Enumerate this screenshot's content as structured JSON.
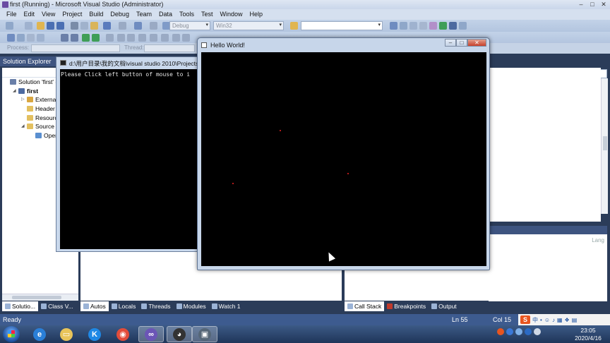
{
  "vs": {
    "title": "first (Running) - Microsoft Visual Studio (Administrator)",
    "window_controls": [
      "–",
      "□",
      "✕"
    ],
    "menu": [
      "File",
      "Edit",
      "View",
      "Project",
      "Build",
      "Debug",
      "Team",
      "Data",
      "Tools",
      "Test",
      "Window",
      "Help"
    ],
    "toolbar": {
      "config": "Debug",
      "platform": "Win32"
    },
    "debug_bar": {
      "process_label": "Process:",
      "thread_label": "Thread:"
    },
    "solution_explorer": {
      "title": "Solution Explorer",
      "items": [
        {
          "label": "Solution 'first' (",
          "indent": 0,
          "icon_color": "#6a7fa8"
        },
        {
          "label": "first",
          "indent": 1,
          "icon_color": "#4d6aa0",
          "bold": true
        },
        {
          "label": "External",
          "indent": 2,
          "icon_color": "#d9a640"
        },
        {
          "label": "Header F",
          "indent": 2,
          "icon_color": "#e3c060"
        },
        {
          "label": "Resource",
          "indent": 2,
          "icon_color": "#e3c060"
        },
        {
          "label": "Source F",
          "indent": 2,
          "icon_color": "#e3c060"
        },
        {
          "label": "Oper",
          "indent": 3,
          "icon_color": "#5a8fd0"
        }
      ]
    },
    "left_tabs": [
      "Solutio...",
      "Class V..."
    ],
    "debug_tabs": [
      "Autos",
      "Locals",
      "Threads",
      "Modules",
      "Watch 1"
    ],
    "right_tabs": [
      "Call Stack",
      "Breakpoints",
      "Output"
    ],
    "lang_header": "Lang",
    "status": {
      "ready": "Ready",
      "line": "Ln 55",
      "col": "Col 15"
    },
    "ime": {
      "logo": "S",
      "mode": "中"
    }
  },
  "console": {
    "title": "d:\\用户目录\\我的文档\\visual studio 2010\\Projects\\",
    "text": "Please Click left button of mouse to i"
  },
  "hello_window": {
    "title": "Hello World!",
    "buttons": [
      "–",
      "□",
      "✕"
    ],
    "dot_color": "#b01a1a"
  },
  "taskbar": {
    "apps": [
      {
        "name": "internet-explorer-icon",
        "glyph": "e",
        "color": "#2a7fd8"
      },
      {
        "name": "file-explorer-icon",
        "glyph": "▭",
        "color": "#e8c45a"
      },
      {
        "name": "kugou-icon",
        "glyph": "K",
        "color": "#1e88e5"
      },
      {
        "name": "chrome-icon",
        "glyph": "◉",
        "color": "#e24c3a"
      },
      {
        "name": "visual-studio-icon",
        "glyph": "∞",
        "color": "#6b55b6"
      },
      {
        "name": "panda-app-icon",
        "glyph": "◕",
        "color": "#333333"
      },
      {
        "name": "console-window-icon",
        "glyph": "▣",
        "color": "#556677"
      }
    ],
    "clock_time": "23:05",
    "clock_date": "2020/4/16"
  }
}
